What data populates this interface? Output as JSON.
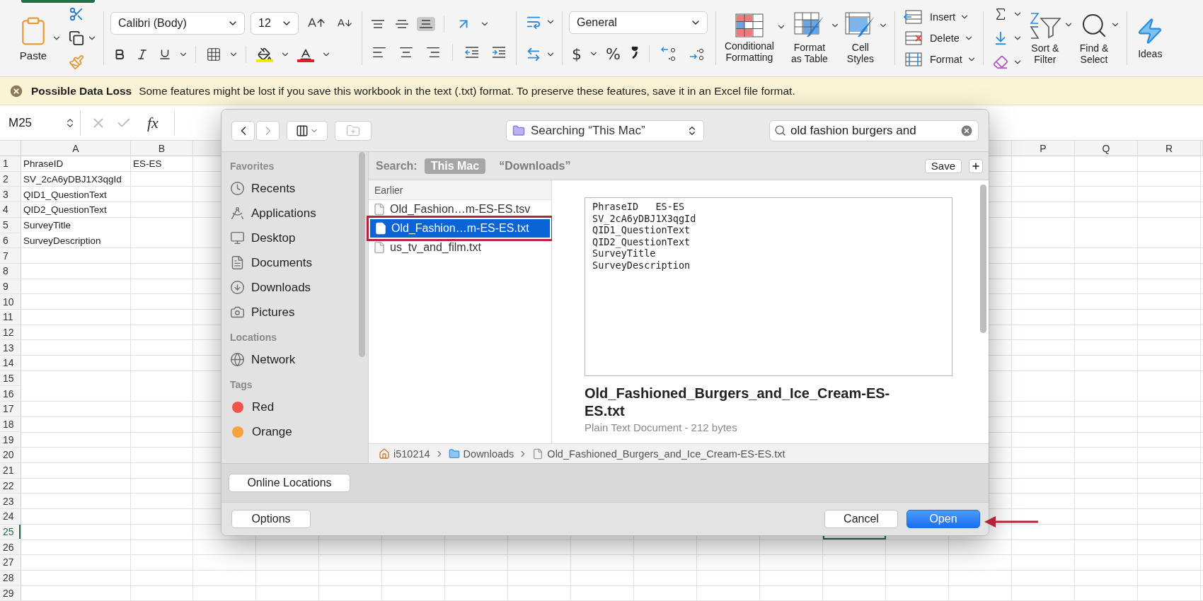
{
  "ribbon": {
    "paste": "Paste",
    "font_name": "Calibri (Body)",
    "font_size": "12",
    "vertical_align": [
      {
        "kind": "top",
        "selected": false
      },
      {
        "kind": "middle",
        "selected": false
      },
      {
        "kind": "bottom",
        "selected": true
      }
    ],
    "number_format": "General",
    "number_symbols": [
      "$",
      "%"
    ],
    "styles": [
      {
        "kind": "conditional",
        "lines": [
          "Conditional",
          "Formatting"
        ]
      },
      {
        "kind": "table",
        "lines": [
          "Format",
          "as Table"
        ]
      },
      {
        "kind": "cell",
        "lines": [
          "Cell",
          "Styles"
        ]
      }
    ],
    "cells": [
      {
        "kind": "insert",
        "label": "Insert"
      },
      {
        "kind": "delete",
        "label": "Delete"
      },
      {
        "kind": "format",
        "label": "Format"
      }
    ],
    "editing": [
      {
        "kind": "sort",
        "lines": [
          "Sort &",
          "Filter"
        ]
      },
      {
        "kind": "find",
        "lines": [
          "Find &",
          "Select"
        ]
      }
    ],
    "ideas": "Ideas"
  },
  "message_bar": {
    "title": "Possible Data Loss",
    "text": "Some features might be lost if you save this workbook in the text (.txt) format. To preserve these features, save it in an Excel file format."
  },
  "formula_bar": {
    "name_box": "M25",
    "function_label": "fx"
  },
  "sheet": {
    "columns_left": [
      "A",
      "B"
    ],
    "columns_right": [
      "P",
      "Q",
      "R"
    ],
    "rows": [
      {
        "number": "1",
        "cells": [
          "PhraseID",
          "ES-ES"
        ],
        "selected": false
      },
      {
        "number": "2",
        "cells": [
          "SV_2cA6yDBJ1X3qgId"
        ],
        "selected": false
      },
      {
        "number": "3",
        "cells": [
          "QID1_QuestionText"
        ],
        "selected": false
      },
      {
        "number": "4",
        "cells": [
          "QID2_QuestionText"
        ],
        "selected": false
      },
      {
        "number": "5",
        "cells": [
          "SurveyTitle"
        ],
        "selected": false
      },
      {
        "number": "6",
        "cells": [
          "SurveyDescription"
        ],
        "selected": false
      },
      {
        "number": "7",
        "selected": false
      },
      {
        "number": "8",
        "selected": false
      },
      {
        "number": "9",
        "selected": false
      },
      {
        "number": "10",
        "selected": false
      },
      {
        "number": "11",
        "selected": false
      },
      {
        "number": "12",
        "selected": false
      },
      {
        "number": "13",
        "selected": false
      },
      {
        "number": "14",
        "selected": false
      },
      {
        "number": "15",
        "selected": false
      },
      {
        "number": "16",
        "selected": false
      },
      {
        "number": "17",
        "selected": false
      },
      {
        "number": "18",
        "selected": false
      },
      {
        "number": "19",
        "selected": false
      },
      {
        "number": "20",
        "selected": false
      },
      {
        "number": "21",
        "selected": false
      },
      {
        "number": "22",
        "selected": false
      },
      {
        "number": "23",
        "selected": false
      },
      {
        "number": "24",
        "selected": false
      },
      {
        "number": "25",
        "selected": true
      },
      {
        "number": "26",
        "selected": false
      },
      {
        "number": "27",
        "selected": false
      },
      {
        "number": "28",
        "selected": false
      },
      {
        "number": "29",
        "selected": false
      }
    ]
  },
  "dialog": {
    "location": "Searching “This Mac”",
    "search": {
      "value": "old fashion burgers and"
    },
    "sidebar": [
      {
        "heading": "Favorites",
        "items": [
          {
            "kind": "recents",
            "label": "Recents"
          },
          {
            "kind": "applications",
            "label": "Applications"
          },
          {
            "kind": "desktop",
            "label": "Desktop"
          },
          {
            "kind": "documents",
            "label": "Documents"
          },
          {
            "kind": "downloads",
            "label": "Downloads"
          },
          {
            "kind": "pictures",
            "label": "Pictures"
          }
        ]
      },
      {
        "heading": "Locations",
        "items": [
          {
            "kind": "network",
            "label": "Network"
          }
        ]
      },
      {
        "heading": "Tags",
        "items": [
          {
            "kind": "tag",
            "label": "Red",
            "color": "#f0524c"
          },
          {
            "kind": "tag",
            "label": "Orange",
            "color": "#f6a23c"
          }
        ]
      }
    ],
    "scope": {
      "label": "Search:",
      "options": [
        {
          "label": "This Mac",
          "selected": true
        },
        {
          "label": "“Downloads”",
          "selected": false
        }
      ],
      "save": "Save"
    },
    "results": {
      "heading": "Earlier",
      "files": [
        {
          "name": "Old_Fashion…m-ES-ES.tsv",
          "selected": false,
          "annotated": false
        },
        {
          "name": "Old_Fashion…m-ES-ES.txt",
          "selected": true,
          "annotated": true
        },
        {
          "name": "us_tv_and_film.txt",
          "selected": false,
          "annotated": false
        }
      ]
    },
    "preview": {
      "lines": [
        "PhraseID\tES-ES",
        "SV_2cA6yDBJ1X3qgId",
        "QID1_QuestionText",
        "QID2_QuestionText",
        "SurveyTitle",
        "SurveyDescription"
      ],
      "title": "Old_Fashioned_Burgers_and_Ice_Cream-ES-ES.txt",
      "info": "Plain Text Document - 212 bytes"
    },
    "path": [
      {
        "kind": "home",
        "label": "i510214"
      },
      {
        "kind": "folder",
        "label": "Downloads"
      },
      {
        "kind": "file",
        "label": "Old_Fashioned_Burgers_and_Ice_Cream-ES-ES.txt"
      }
    ],
    "online_locations": "Online Locations",
    "buttons": [
      {
        "kind": "options",
        "label": "Options",
        "default": false
      },
      {
        "kind": "cancel",
        "label": "Cancel",
        "default": false
      },
      {
        "kind": "open",
        "label": "Open",
        "default": true
      }
    ]
  }
}
